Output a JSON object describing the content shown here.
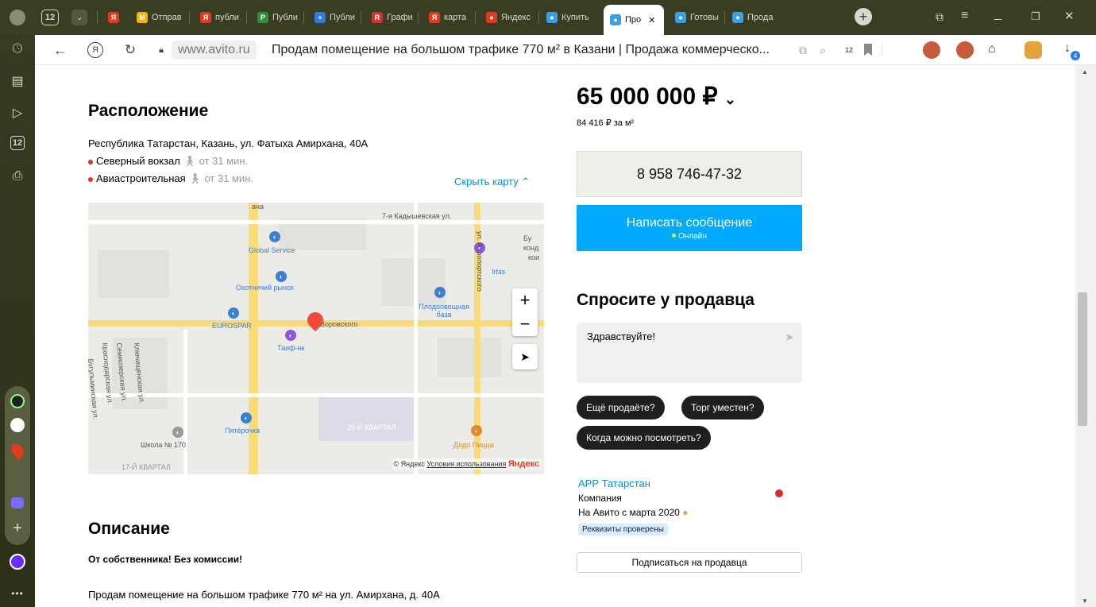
{
  "browser": {
    "tab_count": "12",
    "tabs": [
      {
        "label": "Отправ",
        "fav": "M",
        "color": "#f5b400"
      },
      {
        "label": "публи",
        "fav": "Я",
        "color": "#e23a1e"
      },
      {
        "label": "Публи",
        "fav": "P",
        "color": "#2f8f3d"
      },
      {
        "label": "Публи",
        "fav": "+",
        "color": "#2a7de1"
      },
      {
        "label": "Графи",
        "fav": "R",
        "color": "#d2322d"
      },
      {
        "label": "карта",
        "fav": "Я",
        "color": "#e23a1e"
      },
      {
        "label": "Яндекс",
        "fav": "●",
        "color": "#e23a1e"
      },
      {
        "label": "Купить",
        "fav": "●",
        "color": "#3aa0e6"
      },
      {
        "label": "Про",
        "fav": "●",
        "color": "#3aa0e6",
        "active": true
      },
      {
        "label": "Готовы",
        "fav": "●",
        "color": "#3aa0e6"
      },
      {
        "label": "Прода",
        "fav": "●",
        "color": "#3aa0e6"
      }
    ],
    "yandex_logo": "Я",
    "domain": "www.avito.ru",
    "page_title": "Продам помещение на большом трафике 770 м² в Казани | Продажа коммерческо...",
    "shield_count": "12",
    "download_count": "4"
  },
  "location": {
    "heading": "Расположение",
    "address": "Республика Татарстан, Казань, ул. Фатыха Амирхана, 40А",
    "stations": [
      {
        "name": "Северный вокзал",
        "time": "от 31 мин."
      },
      {
        "name": "Авиастроительная",
        "time": "от 31 мин."
      }
    ],
    "hide_map": "Скрыть карту"
  },
  "map": {
    "labels": {
      "kadyshevskaya": "7-я Кадышевская ул.",
      "global_service": "Global Service",
      "irbis": "Irbis",
      "okhotnichiy": "Охотничий рынок",
      "plodoovoshchnaya": "Плодоовощная база",
      "eurospar": "EUROSPAR",
      "vorovskogo": "Воровского",
      "taif": "Таиф-нк",
      "pyaterochka": "Пятёрочка",
      "kvartal25": "25-Й КВАРТАЛ",
      "dodo": "Додо Пицца",
      "school": "Школа № 170",
      "kvartal17": "17-Й КВАРТАЛ",
      "bu": "Бу",
      "kond": "конд",
      "koi": "кои",
      "aeroport": "ул. Аэропортского",
      "ana": "ана",
      "krasnodarskaya": "Краснодарская ул.",
      "klyuchishchenskaya": "Ключищенская ул.",
      "semiozerskaya": "Семиозерская ул.",
      "bugulminskaya": "Бугульминская ул."
    },
    "copyright": "© Яндекс",
    "terms": "Условия использования",
    "brand": "Яндекс",
    "zoom_in": "+",
    "zoom_out": "−"
  },
  "description": {
    "heading": "Описание",
    "bold": "От собственника! Без комиссии!",
    "text": "Продам помещение на большом трафике 770 м² на ул. Амирхана, д. 40А"
  },
  "price": {
    "value": "65 000 000 ₽",
    "per_m2": "84 416 ₽ за м²"
  },
  "contact": {
    "phone": "8 958 746-47-32",
    "message_button": "Написать сообщение",
    "online": "Онлайн"
  },
  "ask": {
    "heading": "Спросите у продавца",
    "input_value": "Здравствуйте!",
    "chips": [
      "Ещё продаёте?",
      "Торг уместен?",
      "Когда можно посмотреть?"
    ]
  },
  "seller": {
    "name": "АРР Татарстан",
    "type": "Компания",
    "since": "На Авито с марта 2020",
    "verified": "Реквизиты проверены",
    "subscribe": "Подписаться на продавца"
  }
}
